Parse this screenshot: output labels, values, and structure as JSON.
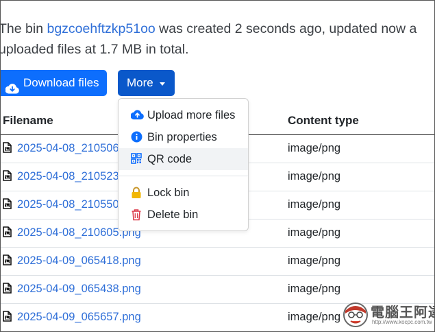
{
  "intro": {
    "prefix": "The bin ",
    "bin_id": "bgzcoehftzkp51oo",
    "suffix": " was created 2 seconds ago, updated now a",
    "line2": "uploaded files at 1.7 MB in total."
  },
  "toolbar": {
    "download_label": "Download files",
    "more_label": "More"
  },
  "table": {
    "headers": {
      "filename": "Filename",
      "content_type": "Content type"
    },
    "rows": [
      {
        "name": "2025-04-08_210506.png",
        "type": "image/png"
      },
      {
        "name": "2025-04-08_210523.png",
        "type": "image/png"
      },
      {
        "name": "2025-04-08_210550.png",
        "type": "image/png"
      },
      {
        "name": "2025-04-08_210605.png",
        "type": "image/png"
      },
      {
        "name": "2025-04-09_065418.png",
        "type": "image/png"
      },
      {
        "name": "2025-04-09_065438.png",
        "type": "image/png"
      },
      {
        "name": "2025-04-09_065657.png",
        "type": "image/png"
      }
    ]
  },
  "menu": {
    "items": [
      {
        "label": "Upload more files",
        "icon": "cloud-upload-icon"
      },
      {
        "label": "Bin properties",
        "icon": "info-circle-icon"
      },
      {
        "label": "QR code",
        "icon": "qr-code-icon"
      },
      {
        "label": "Lock bin",
        "icon": "lock-icon"
      },
      {
        "label": "Delete bin",
        "icon": "trash-icon"
      }
    ]
  },
  "watermark": {
    "text": "電腦王阿達",
    "url": "http://www.kocpc.com.tw"
  },
  "colors": {
    "primary": "#0d6efd",
    "primary_dark": "#0a58ca",
    "link": "#2f6fd8",
    "info": "#0d6efd",
    "lock": "#f2b705",
    "danger": "#dc3545"
  }
}
